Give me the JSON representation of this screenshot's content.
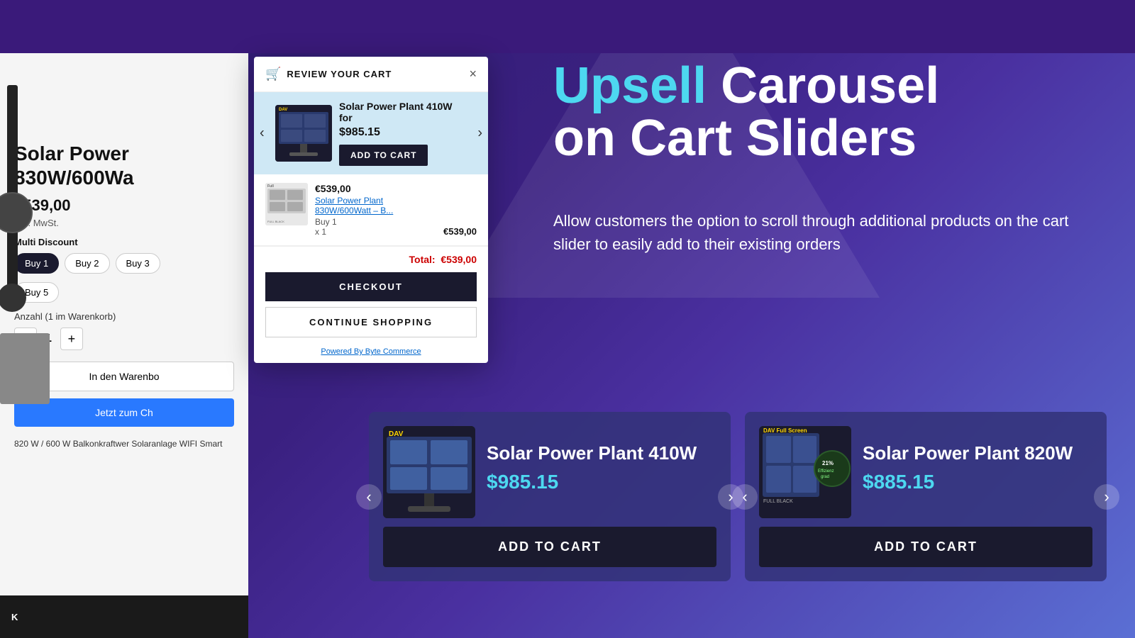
{
  "header": {
    "background_color": "#3a1a7a"
  },
  "left_panel": {
    "product_title": "Solar Power",
    "product_title_line2": "830W/600Wa",
    "product_price": "€539,00",
    "product_tax": "inkl. MwSt.",
    "multi_discount_label": "Multi Discount",
    "discount_options": [
      "Buy 1",
      "Buy 2",
      "Buy 3",
      "Buy 5"
    ],
    "active_discount": "Buy 1",
    "qty_label": "Anzahl (1 im Warenkorb)",
    "qty_value": "1",
    "add_to_cart_label": "In den Warenbo",
    "buy_now_label": "Jetzt zum Ch",
    "product_desc": "820 W / 600 W Balkonkraftwer\nSolaranlage WIFI Smart"
  },
  "cart_modal": {
    "title": "REVIEW YOUR CART",
    "close_icon": "×",
    "upsell_item": {
      "name": "Solar Power Plant 410W for",
      "price": "$985.15",
      "add_to_cart_label": "ADD TO CART"
    },
    "prev_icon": "‹",
    "next_icon": "›",
    "cart_items": [
      {
        "price": "€539,00",
        "name": "Solar Power Plant 830W/600Watt – B...",
        "buy_qty": "Buy 1",
        "qty": "x 1",
        "total": "€539,00"
      }
    ],
    "total_label": "Total:",
    "total_value": "€539,00",
    "checkout_label": "CHECKOUT",
    "continue_shopping_label": "CONTINUE SHOPPING",
    "powered_by": "Powered By Byte Commerce"
  },
  "marketing": {
    "heading_highlighted": "Upsell",
    "heading_rest": " Carousel",
    "heading_line2": "on Cart Sliders",
    "subtext": "Allow customers the option to scroll through additional products on the cart slider to easily add to their existing orders"
  },
  "carousel": {
    "cards": [
      {
        "name": "Solar Power Plant 410W",
        "price": "$985.15",
        "add_to_cart_label": "ADD TO CART",
        "prev_icon": "‹",
        "next_icon": "›"
      },
      {
        "name": "Solar Power Plant 820W",
        "price": "$885.15",
        "add_to_cart_label": "ADD TO CART",
        "prev_icon": "‹",
        "next_icon": "›"
      }
    ]
  }
}
